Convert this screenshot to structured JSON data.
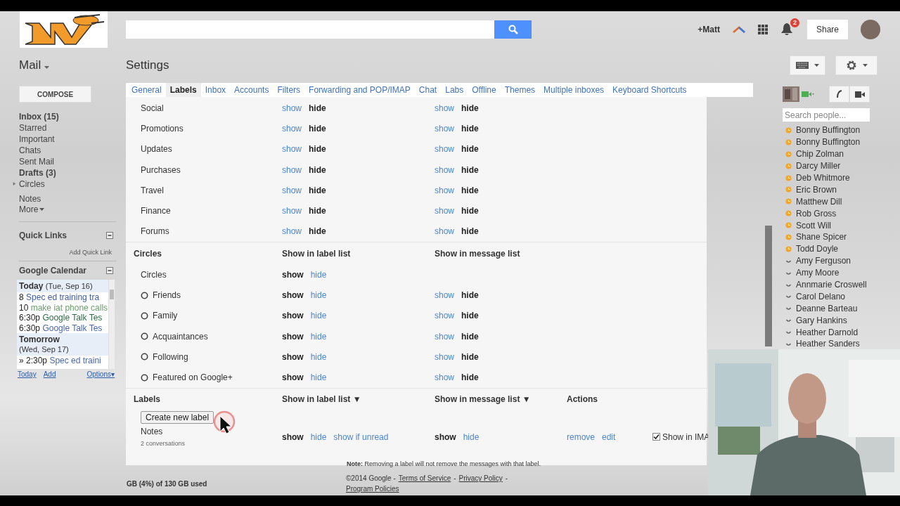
{
  "header": {
    "user": "+Matt",
    "notifications": "2",
    "share": "Share"
  },
  "toolbar": {
    "app": "Mail",
    "title": "Settings"
  },
  "sidebar": {
    "compose": "COMPOSE",
    "items": [
      {
        "label": "Inbox (15)",
        "unread": true
      },
      {
        "label": "Starred",
        "unread": false
      },
      {
        "label": "Important",
        "unread": false
      },
      {
        "label": "Chats",
        "unread": false
      },
      {
        "label": "Sent Mail",
        "unread": false
      },
      {
        "label": "Drafts (3)",
        "unread": true
      },
      {
        "label": "Circles",
        "unread": false,
        "expanded": false
      },
      {
        "label": "Notes",
        "unread": false
      }
    ],
    "more": "More",
    "quick_links": {
      "title": "Quick Links",
      "add": "Add Quick Link"
    },
    "calendar": {
      "title": "Google Calendar",
      "days": [
        {
          "heading": "Today",
          "date": "(Tue, Sep 16)",
          "events": [
            {
              "time": "8",
              "title": "Spec ed training tra",
              "color": "#3f5ca8"
            },
            {
              "time": "10",
              "title": "make iat phone calls",
              "color": "#6a9e6a"
            },
            {
              "time": "6:30p",
              "title": "Google Talk Tes",
              "color": "#2f6b47"
            },
            {
              "time": "6:30p",
              "title": "Google Talk Tes",
              "color": "#4a68b0"
            }
          ]
        },
        {
          "heading": "Tomorrow",
          "date": "(Wed, Sep 17)",
          "events": [
            {
              "time": "» 2:30p",
              "title": "Spec ed traini",
              "color": "#4a68b0"
            }
          ]
        }
      ],
      "links": [
        "Today",
        "Add"
      ],
      "options": "Options▾"
    }
  },
  "settings": {
    "tabs": [
      {
        "label": "General",
        "selected": false
      },
      {
        "label": "Labels",
        "selected": true
      },
      {
        "label": "Inbox",
        "selected": false
      },
      {
        "label": "Accounts",
        "selected": false
      },
      {
        "label": "Filters",
        "selected": false
      },
      {
        "label": "Forwarding and POP/IMAP",
        "selected": false
      },
      {
        "label": "Chat",
        "selected": false
      },
      {
        "label": "Labs",
        "selected": false
      },
      {
        "label": "Offline",
        "selected": false
      },
      {
        "label": "Themes",
        "selected": false
      },
      {
        "label": "Multiple inboxes",
        "selected": false
      },
      {
        "label": "Keyboard Shortcuts",
        "selected": false
      }
    ],
    "sections": [
      {
        "kind": "categories",
        "rows": [
          {
            "kind": "group",
            "name": "Social",
            "label_list": [
              {
                "text": "show",
                "selected": false
              },
              {
                "text": "hide",
                "selected": true
              }
            ],
            "message_list": [
              {
                "text": "show",
                "selected": false
              },
              {
                "text": "hide",
                "selected": true
              }
            ]
          },
          {
            "kind": "group",
            "name": "Promotions",
            "label_list": [
              {
                "text": "show",
                "selected": false
              },
              {
                "text": "hide",
                "selected": true
              }
            ],
            "message_list": [
              {
                "text": "show",
                "selected": false
              },
              {
                "text": "hide",
                "selected": true
              }
            ]
          },
          {
            "kind": "group",
            "name": "Updates",
            "label_list": [
              {
                "text": "show",
                "selected": false
              },
              {
                "text": "hide",
                "selected": true
              }
            ],
            "message_list": [
              {
                "text": "show",
                "selected": false
              },
              {
                "text": "hide",
                "selected": true
              }
            ]
          },
          {
            "kind": "group",
            "name": "Purchases",
            "label_list": [
              {
                "text": "show",
                "selected": false
              },
              {
                "text": "hide",
                "selected": true
              }
            ],
            "message_list": [
              {
                "text": "show",
                "selected": false
              },
              {
                "text": "hide",
                "selected": true
              }
            ]
          },
          {
            "kind": "group",
            "name": "Travel",
            "label_list": [
              {
                "text": "show",
                "selected": false
              },
              {
                "text": "hide",
                "selected": true
              }
            ],
            "message_list": [
              {
                "text": "show",
                "selected": false
              },
              {
                "text": "hide",
                "selected": true
              }
            ]
          },
          {
            "kind": "group",
            "name": "Finance",
            "label_list": [
              {
                "text": "show",
                "selected": false
              },
              {
                "text": "hide",
                "selected": true
              }
            ],
            "message_list": [
              {
                "text": "show",
                "selected": false
              },
              {
                "text": "hide",
                "selected": true
              }
            ]
          },
          {
            "kind": "group",
            "name": "Forums",
            "label_list": [
              {
                "text": "show",
                "selected": false
              },
              {
                "text": "hide",
                "selected": true
              }
            ],
            "message_list": [
              {
                "text": "show",
                "selected": false
              },
              {
                "text": "hide",
                "selected": true
              }
            ]
          }
        ]
      },
      {
        "kind": "circles",
        "title": "Circles",
        "columns": [
          "Show in label list",
          "Show in message list"
        ],
        "rows": [
          {
            "kind": "group",
            "name": "Circles",
            "label_list": [
              {
                "text": "show",
                "selected": true
              },
              {
                "text": "hide",
                "selected": false
              }
            ]
          },
          {
            "kind": "circle",
            "name": "Friends",
            "label_list": [
              {
                "text": "show",
                "selected": true
              },
              {
                "text": "hide",
                "selected": false
              }
            ],
            "message_list": [
              {
                "text": "show",
                "selected": false
              },
              {
                "text": "hide",
                "selected": true
              }
            ]
          },
          {
            "kind": "circle",
            "name": "Family",
            "label_list": [
              {
                "text": "show",
                "selected": true
              },
              {
                "text": "hide",
                "selected": false
              }
            ],
            "message_list": [
              {
                "text": "show",
                "selected": false
              },
              {
                "text": "hide",
                "selected": true
              }
            ]
          },
          {
            "kind": "circle",
            "name": "Acquaintances",
            "label_list": [
              {
                "text": "show",
                "selected": true
              },
              {
                "text": "hide",
                "selected": false
              }
            ],
            "message_list": [
              {
                "text": "show",
                "selected": false
              },
              {
                "text": "hide",
                "selected": true
              }
            ]
          },
          {
            "kind": "circle",
            "name": "Following",
            "label_list": [
              {
                "text": "show",
                "selected": true
              },
              {
                "text": "hide",
                "selected": false
              }
            ],
            "message_list": [
              {
                "text": "show",
                "selected": false
              },
              {
                "text": "hide",
                "selected": true
              }
            ]
          },
          {
            "kind": "circle",
            "name": "Featured on Google+",
            "label_list": [
              {
                "text": "show",
                "selected": true
              },
              {
                "text": "hide",
                "selected": false
              }
            ],
            "message_list": [
              {
                "text": "show",
                "selected": false
              },
              {
                "text": "hide",
                "selected": true
              }
            ]
          }
        ]
      },
      {
        "kind": "labels",
        "title": "Labels",
        "columns": [
          "Show in label list ▼",
          "Show in message list ▼",
          "Actions"
        ],
        "create_button": "Create new label",
        "rows": [
          {
            "kind": "label",
            "name": "Notes",
            "count": "2 conversations",
            "label_list": [
              {
                "text": "show",
                "selected": true
              },
              {
                "text": "hide",
                "selected": false
              },
              {
                "text": "show if unread",
                "selected": false
              }
            ],
            "message_list": [
              {
                "text": "show",
                "selected": true
              },
              {
                "text": "hide",
                "selected": false
              }
            ],
            "actions": [
              "remove",
              "edit"
            ],
            "imap": {
              "label": "Show in IMA",
              "checked": true
            }
          }
        ],
        "note": "**Note:** Removing a label will not remove the messages with that label."
      }
    ]
  },
  "people": {
    "search": {
      "placeholder": "Search people..."
    },
    "contacts": [
      {
        "name": "Bonny Buffington",
        "kind": "idle",
        "color": "#f4a52b"
      },
      {
        "name": "Bonny Buffington",
        "kind": "idle",
        "color": "#f4a52b"
      },
      {
        "name": "Chip Zolman",
        "kind": "idle",
        "color": "#f4a52b"
      },
      {
        "name": "Darcy Miller",
        "kind": "idle",
        "color": "#f4a52b"
      },
      {
        "name": "Deb Whitmore",
        "kind": "idle",
        "color": "#f4a52b"
      },
      {
        "name": "Eric Brown",
        "kind": "idle",
        "color": "#f4a52b"
      },
      {
        "name": "Matthew Dill",
        "kind": "idle",
        "color": "#f4a52b"
      },
      {
        "name": "Rob Gross",
        "kind": "idle",
        "color": "#f4a52b"
      },
      {
        "name": "Scott Will",
        "kind": "idle",
        "color": "#f4a52b"
      },
      {
        "name": "Shane Spicer",
        "kind": "idle",
        "color": "#f4a52b"
      },
      {
        "name": "Todd Doyle",
        "kind": "idle",
        "color": "#f4a52b"
      },
      {
        "name": "Amy Ferguson",
        "kind": "mobile",
        "color": "#666666"
      },
      {
        "name": "Amy Moore",
        "kind": "mobile",
        "color": "#666666"
      },
      {
        "name": "Annmarie Croswell",
        "kind": "mobile",
        "color": "#666666"
      },
      {
        "name": "Carol Delano",
        "kind": "mobile",
        "color": "#666666"
      },
      {
        "name": "Deanne Barteau",
        "kind": "mobile",
        "color": "#666666"
      },
      {
        "name": "Gary Hankins",
        "kind": "mobile",
        "color": "#666666"
      },
      {
        "name": "Heather Darnold",
        "kind": "mobile",
        "color": "#666666"
      },
      {
        "name": "Heather Sanders",
        "kind": "mobile",
        "color": "#666666"
      }
    ]
  },
  "footer": {
    "storage": "GB (4%) of 130 GB used",
    "copyright": "©2014 Google -",
    "links": [
      {
        "text": "Terms of Service",
        "after": "-"
      },
      {
        "text": "Privacy Policy",
        "after": "-"
      },
      {
        "text": "Program Policies"
      }
    ]
  }
}
